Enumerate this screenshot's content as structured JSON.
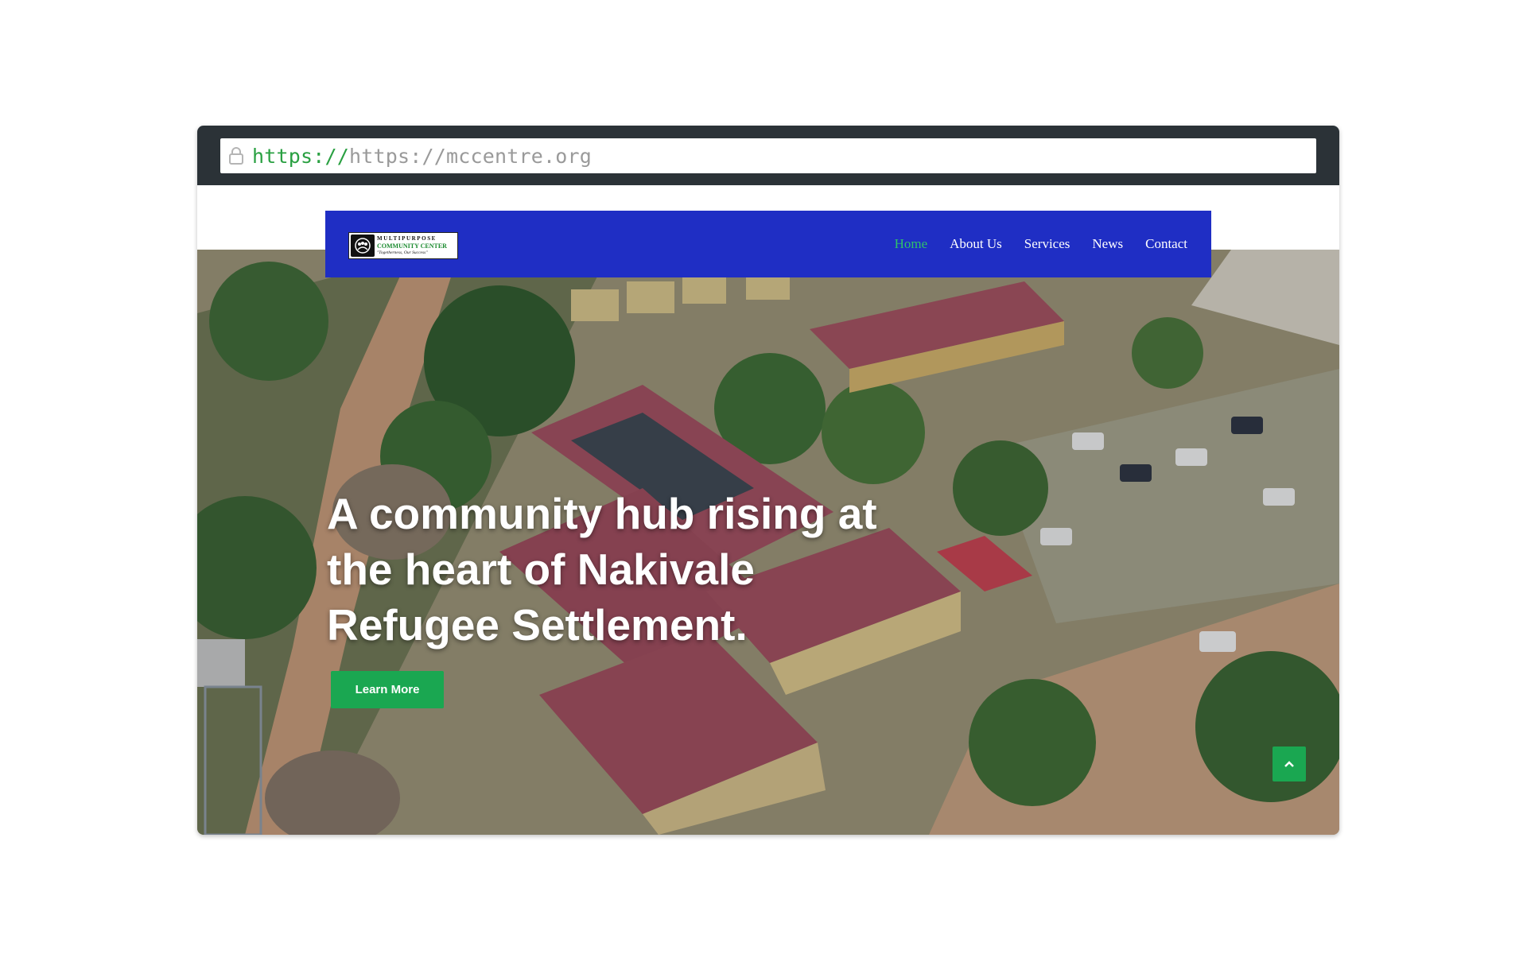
{
  "browser": {
    "url_scheme": "https://",
    "url_text": "https://mccentre.org",
    "icons": {
      "lock": "lock-icon"
    }
  },
  "site": {
    "logo": {
      "line1": "MULTIPURPOSE",
      "line2": "COMMUNITY CENTER",
      "line3": "\"Togetherness, Our Success\""
    },
    "nav": {
      "items": [
        {
          "label": "Home",
          "active": true
        },
        {
          "label": "About Us",
          "active": false
        },
        {
          "label": "Services",
          "active": false
        },
        {
          "label": "News",
          "active": false
        },
        {
          "label": "Contact",
          "active": false
        }
      ]
    },
    "hero": {
      "headline_lines": [
        "A community hub rising at",
        "the heart of Nakivale",
        "Refugee Settlement."
      ],
      "button_label": "Learn More"
    },
    "back_to_top_icon": "chevron-up-icon"
  },
  "colors": {
    "nav_background": "#1f2ec4",
    "nav_active": "#2fc16a",
    "button_green": "#1aa751",
    "browser_chrome": "#2b3237",
    "url_scheme": "#2aa042"
  }
}
